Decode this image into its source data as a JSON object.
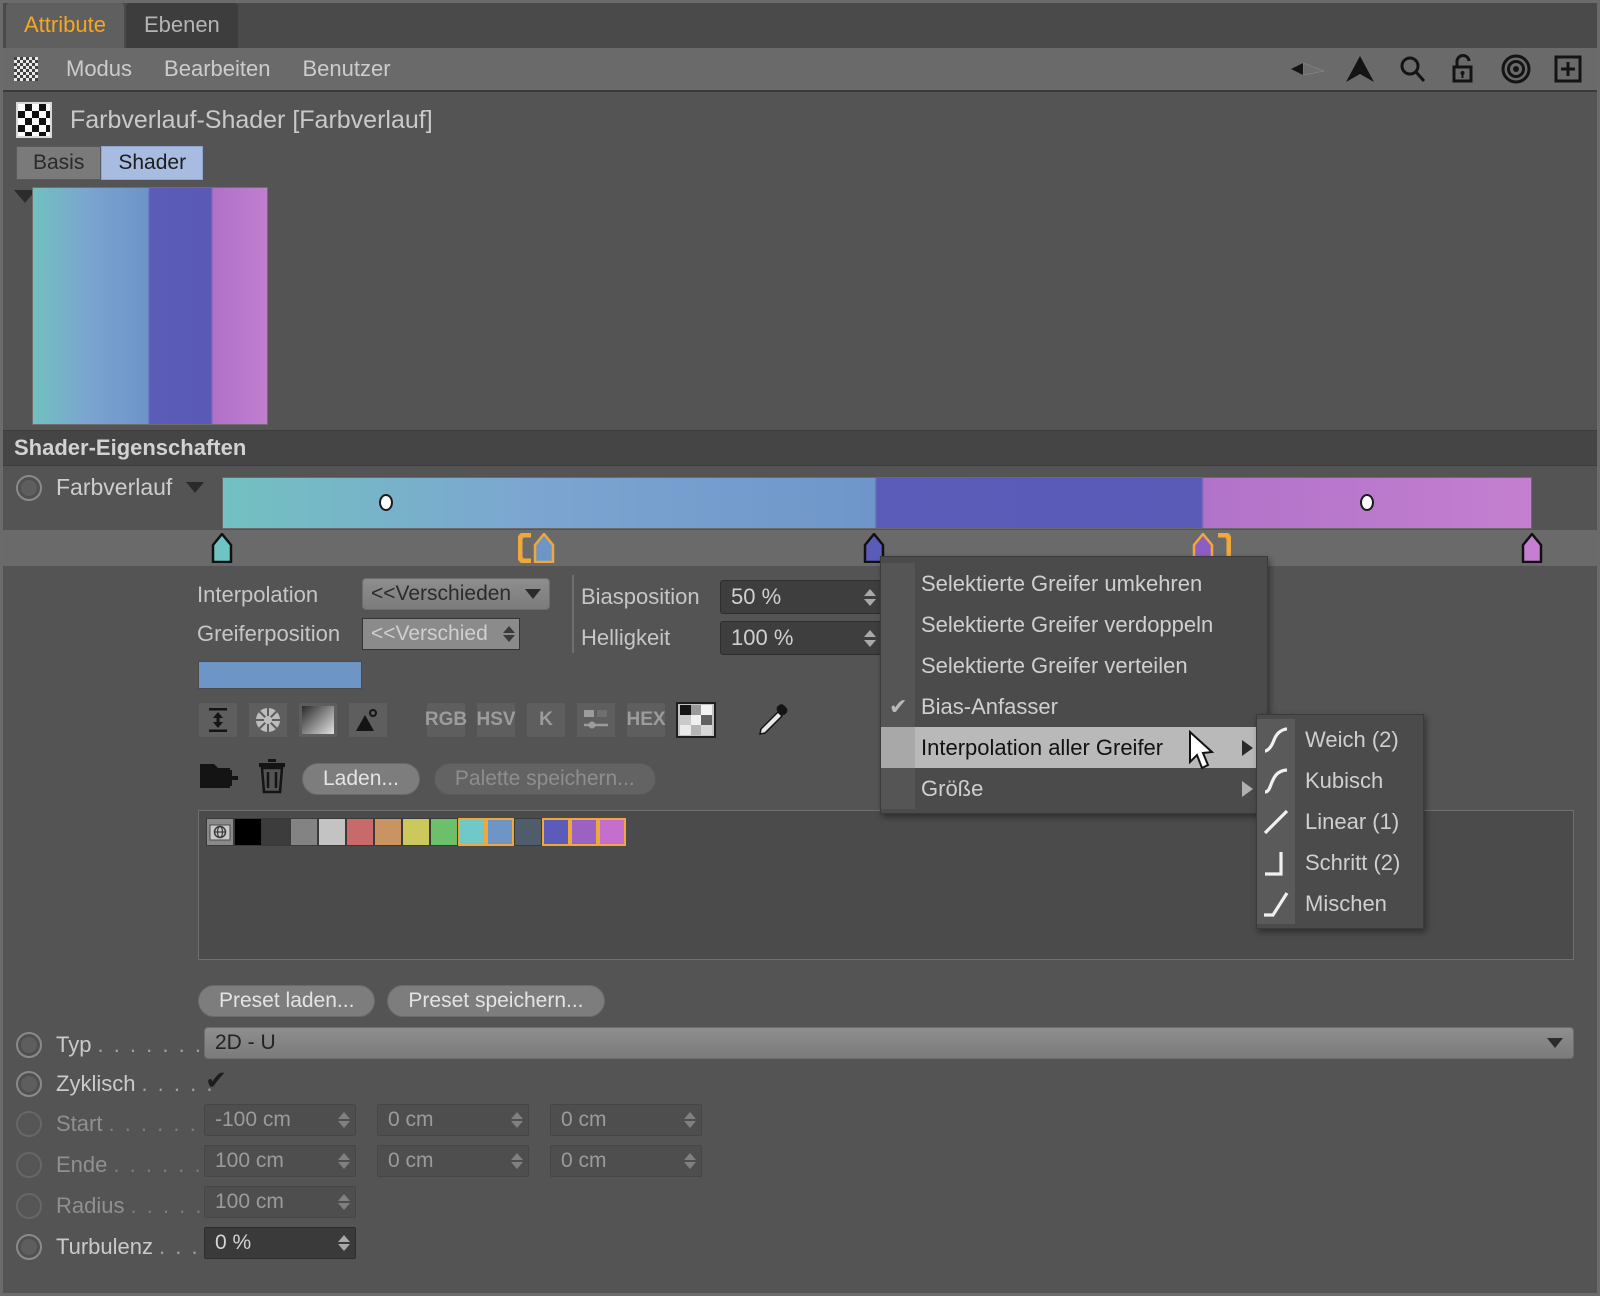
{
  "tabs": [
    {
      "label": "Attribute",
      "active": true
    },
    {
      "label": "Ebenen",
      "active": false
    }
  ],
  "menubar": {
    "items": [
      "Modus",
      "Bearbeiten",
      "Benutzer"
    ],
    "icons": [
      "back-arrow-icon",
      "up-arrow-icon",
      "search-icon",
      "unlock-icon",
      "target-icon",
      "add-panel-icon"
    ]
  },
  "header": {
    "title": "Farbverlauf-Shader [Farbverlauf]",
    "icon": "checkerboard-icon"
  },
  "subtabs": [
    {
      "label": "Basis",
      "selected": false
    },
    {
      "label": "Shader",
      "selected": true
    }
  ],
  "section": {
    "title": "Shader-Eigenschaften"
  },
  "gradient": {
    "label": "Farbverlauf",
    "preview_stops": [
      {
        "pos": 0,
        "color": "#72c0c0"
      },
      {
        "pos": 24,
        "color": "#7ba4d0"
      },
      {
        "pos": 49,
        "color": "#6d94c8"
      },
      {
        "pos": 50,
        "color": "#5b5bb8"
      },
      {
        "pos": 76,
        "color": "#5a5ab6"
      },
      {
        "pos": 77,
        "color": "#b071c8"
      },
      {
        "pos": 100,
        "color": "#c07ece"
      }
    ],
    "bar_stops": [
      {
        "pos": 0,
        "color": "#73c1c1"
      },
      {
        "pos": 24,
        "color": "#7ca5d1"
      },
      {
        "pos": 49.8,
        "color": "#6f96c9"
      },
      {
        "pos": 50,
        "color": "#5b5bb9"
      },
      {
        "pos": 74.8,
        "color": "#5a5ab7"
      },
      {
        "pos": 75,
        "color": "#b173c9"
      },
      {
        "pos": 100,
        "color": "#c47fd0"
      }
    ],
    "knots": [
      {
        "pos_pct": 0,
        "color": "#6fc3c3",
        "selected": false,
        "bias_bracket": null
      },
      {
        "pos_pct": 24.6,
        "color": "#6d96c6",
        "selected": true,
        "bias_bracket": "left"
      },
      {
        "pos_pct": 49.8,
        "color": "#5b5bb9",
        "selected": false,
        "bias_bracket": null
      },
      {
        "pos_pct": 74.9,
        "color": "#8d5ec2",
        "selected": true,
        "bias_bracket": "right"
      },
      {
        "pos_pct": 100,
        "color": "#c47fd0",
        "selected": false,
        "bias_bracket": null
      }
    ],
    "midpoint_dots": [
      {
        "pos_pct": 12.5
      },
      {
        "pos_pct": 87.4
      }
    ]
  },
  "params": {
    "interpolation_label": "Interpolation",
    "interpolation_value": "<<Verschieden",
    "greiferposition_label": "Greiferposition",
    "greiferposition_value": "<<Verschied",
    "biasposition_label": "Biasposition",
    "biasposition_value": "50 %",
    "helligkeit_label": "Helligkeit",
    "helligkeit_value": "100 %",
    "color_swatch": "#6d96c6"
  },
  "color_toolbar": [
    {
      "name": "flip-arrows-icon",
      "label": ""
    },
    {
      "name": "color-wheel-icon",
      "label": ""
    },
    {
      "name": "gradient-square-icon",
      "label": ""
    },
    {
      "name": "image-picker-icon",
      "label": ""
    },
    {
      "name": "rgb-mode-button",
      "label": "RGB"
    },
    {
      "name": "hsv-mode-button",
      "label": "HSV"
    },
    {
      "name": "kelvin-mode-button",
      "label": "K"
    },
    {
      "name": "mixer-mode-button",
      "label": ""
    },
    {
      "name": "hex-mode-button",
      "label": "HEX"
    },
    {
      "name": "swatches-mode-button",
      "label": ""
    },
    {
      "name": "eyedropper-icon",
      "label": ""
    }
  ],
  "palette": {
    "new_folder_icon": "new-palette-icon",
    "delete_icon": "trash-icon",
    "load_label": "Laden...",
    "save_label": "Palette speichern...",
    "swatches": [
      {
        "color": "#8a8a8a",
        "marked": false,
        "is_globe": true
      },
      {
        "color": "#000000",
        "marked": false
      },
      {
        "color": "#3c3c3c",
        "marked": false
      },
      {
        "color": "#838383",
        "marked": false
      },
      {
        "color": "#c3c3c3",
        "marked": false
      },
      {
        "color": "#c96a6a",
        "marked": false
      },
      {
        "color": "#c99462",
        "marked": false
      },
      {
        "color": "#ccc95c",
        "marked": false
      },
      {
        "color": "#6cc06c",
        "marked": false
      },
      {
        "color": "#6fc9c9",
        "marked": true
      },
      {
        "color": "#6d96c6",
        "marked": true
      },
      {
        "color": "#4e5c6b",
        "marked": false
      },
      {
        "color": "#5b5bb9",
        "marked": true
      },
      {
        "color": "#9a63c3",
        "marked": true
      },
      {
        "color": "#c46fce",
        "marked": true
      }
    ]
  },
  "presets": {
    "load_label": "Preset laden...",
    "save_label": "Preset speichern..."
  },
  "bottom_rows": [
    {
      "name": "typ",
      "label": "Typ",
      "dots": ". . . . . . . .",
      "type": "select",
      "value": "2D - U",
      "enabled": true
    },
    {
      "name": "zyklisch",
      "label": "Zyklisch",
      "dots": ". . . . .",
      "type": "checkbox",
      "value": "✔",
      "enabled": true
    },
    {
      "name": "start",
      "label": "Start",
      "dots": ". . . . . . . .",
      "type": "vector",
      "values": [
        "-100 cm",
        "0 cm",
        "0 cm"
      ],
      "enabled": false
    },
    {
      "name": "ende",
      "label": "Ende",
      "dots": ". . . . . . . .",
      "type": "vector",
      "values": [
        "100 cm",
        "0 cm",
        "0 cm"
      ],
      "enabled": false
    },
    {
      "name": "radius",
      "label": "Radius",
      "dots": ". . . . . . .",
      "type": "number",
      "values": [
        "100 cm"
      ],
      "enabled": false
    },
    {
      "name": "turbulenz",
      "label": "Turbulenz",
      "dots": ". . .",
      "type": "number",
      "values": [
        "0 %"
      ],
      "enabled": true
    }
  ],
  "context_menu": {
    "items": [
      {
        "label": "Selektierte Greifer umkehren",
        "checked": false,
        "submenu": false,
        "highlighted": false
      },
      {
        "label": "Selektierte Greifer verdoppeln",
        "checked": false,
        "submenu": false,
        "highlighted": false
      },
      {
        "label": "Selektierte Greifer verteilen",
        "checked": false,
        "submenu": false,
        "highlighted": false
      },
      {
        "label": "Bias-Anfasser",
        "checked": true,
        "submenu": false,
        "highlighted": false
      },
      {
        "label": "Interpolation aller Greifer",
        "checked": false,
        "submenu": true,
        "highlighted": true
      },
      {
        "label": "Größe",
        "checked": false,
        "submenu": true,
        "highlighted": false
      }
    ]
  },
  "submenu": {
    "items": [
      {
        "label": "Weich (2)",
        "icon": "ease-curve-icon"
      },
      {
        "label": "Kubisch",
        "icon": "cubic-curve-icon"
      },
      {
        "label": "Linear (1)",
        "icon": "linear-line-icon"
      },
      {
        "label": "Schritt (2)",
        "icon": "step-icon"
      },
      {
        "label": "Mischen",
        "icon": "mix-icon"
      }
    ]
  },
  "colors": {
    "accent": "#f5a623",
    "panel_bg": "#545454",
    "menu_bg": "#6a6a6a",
    "selected_tab": "#a8bbe0"
  }
}
